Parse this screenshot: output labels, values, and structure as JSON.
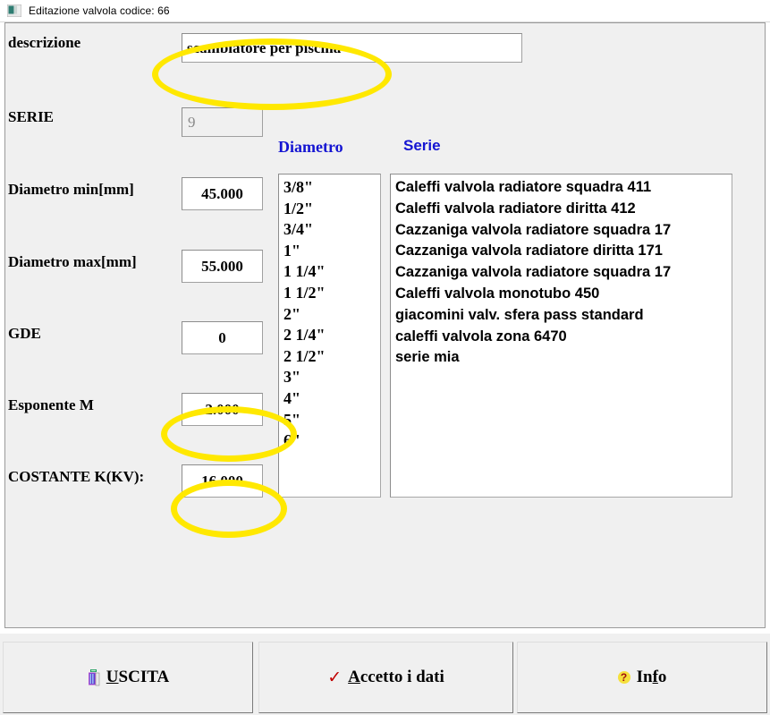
{
  "window": {
    "title": "Editazione valvola codice: 66",
    "icon": "application-icon"
  },
  "form": {
    "labels": {
      "descrizione": "descrizione",
      "serie": "SERIE",
      "diametro_min": "Diametro min[mm]",
      "diametro_max": "Diametro max[mm]",
      "gde": "GDE",
      "esponente_m": "Esponente M",
      "costante_k": "COSTANTE K(KV):"
    },
    "values": {
      "descrizione": "scambiatore per piscina",
      "serie": "9",
      "diametro_min": "45.000",
      "diametro_max": "55.000",
      "gde": "0",
      "esponente_m": "2.000",
      "costante_k": "16.000"
    },
    "placeholders": {
      "descrizione": ""
    }
  },
  "lists": {
    "diametro": {
      "header": "Diametro",
      "items": [
        "3/8\"",
        "1/2\"",
        "3/4\"",
        "1\"",
        "1 1/4\"",
        "1 1/2\"",
        "2\"",
        "2 1/4\"",
        "2 1/2\"",
        "3\"",
        "4\"",
        "5\"",
        "6\""
      ]
    },
    "serie": {
      "header": "Serie",
      "items": [
        "Caleffi valvola radiatore squadra 411",
        "Caleffi valvola radiatore diritta 412",
        "Cazzaniga valvola radiatore squadra 17",
        "Cazzaniga valvola radiatore diritta 171",
        "Cazzaniga valvola radiatore squadra 17",
        "Caleffi valvola monotubo 450",
        "giacomini valv. sfera  pass standard",
        "caleffi valvola zona 6470",
        "serie mia"
      ]
    }
  },
  "buttons": {
    "uscita": {
      "label_prefix": "",
      "label": "USCITA",
      "accel": "U",
      "icon": "exit-door-icon"
    },
    "accetto": {
      "label": "Accetto i dati",
      "accel": "A",
      "icon": "red-check-icon"
    },
    "info": {
      "label": "Info",
      "accel": "f",
      "icon": "yellow-question-icon"
    }
  },
  "annotations": {
    "color": "#ffe800",
    "highlights": [
      "descrizione",
      "esponente-m",
      "costante-k"
    ]
  },
  "colors": {
    "header_blue": "#1414d2",
    "panel_bg": "#f0f0f0",
    "field_bg": "#ffffff"
  }
}
